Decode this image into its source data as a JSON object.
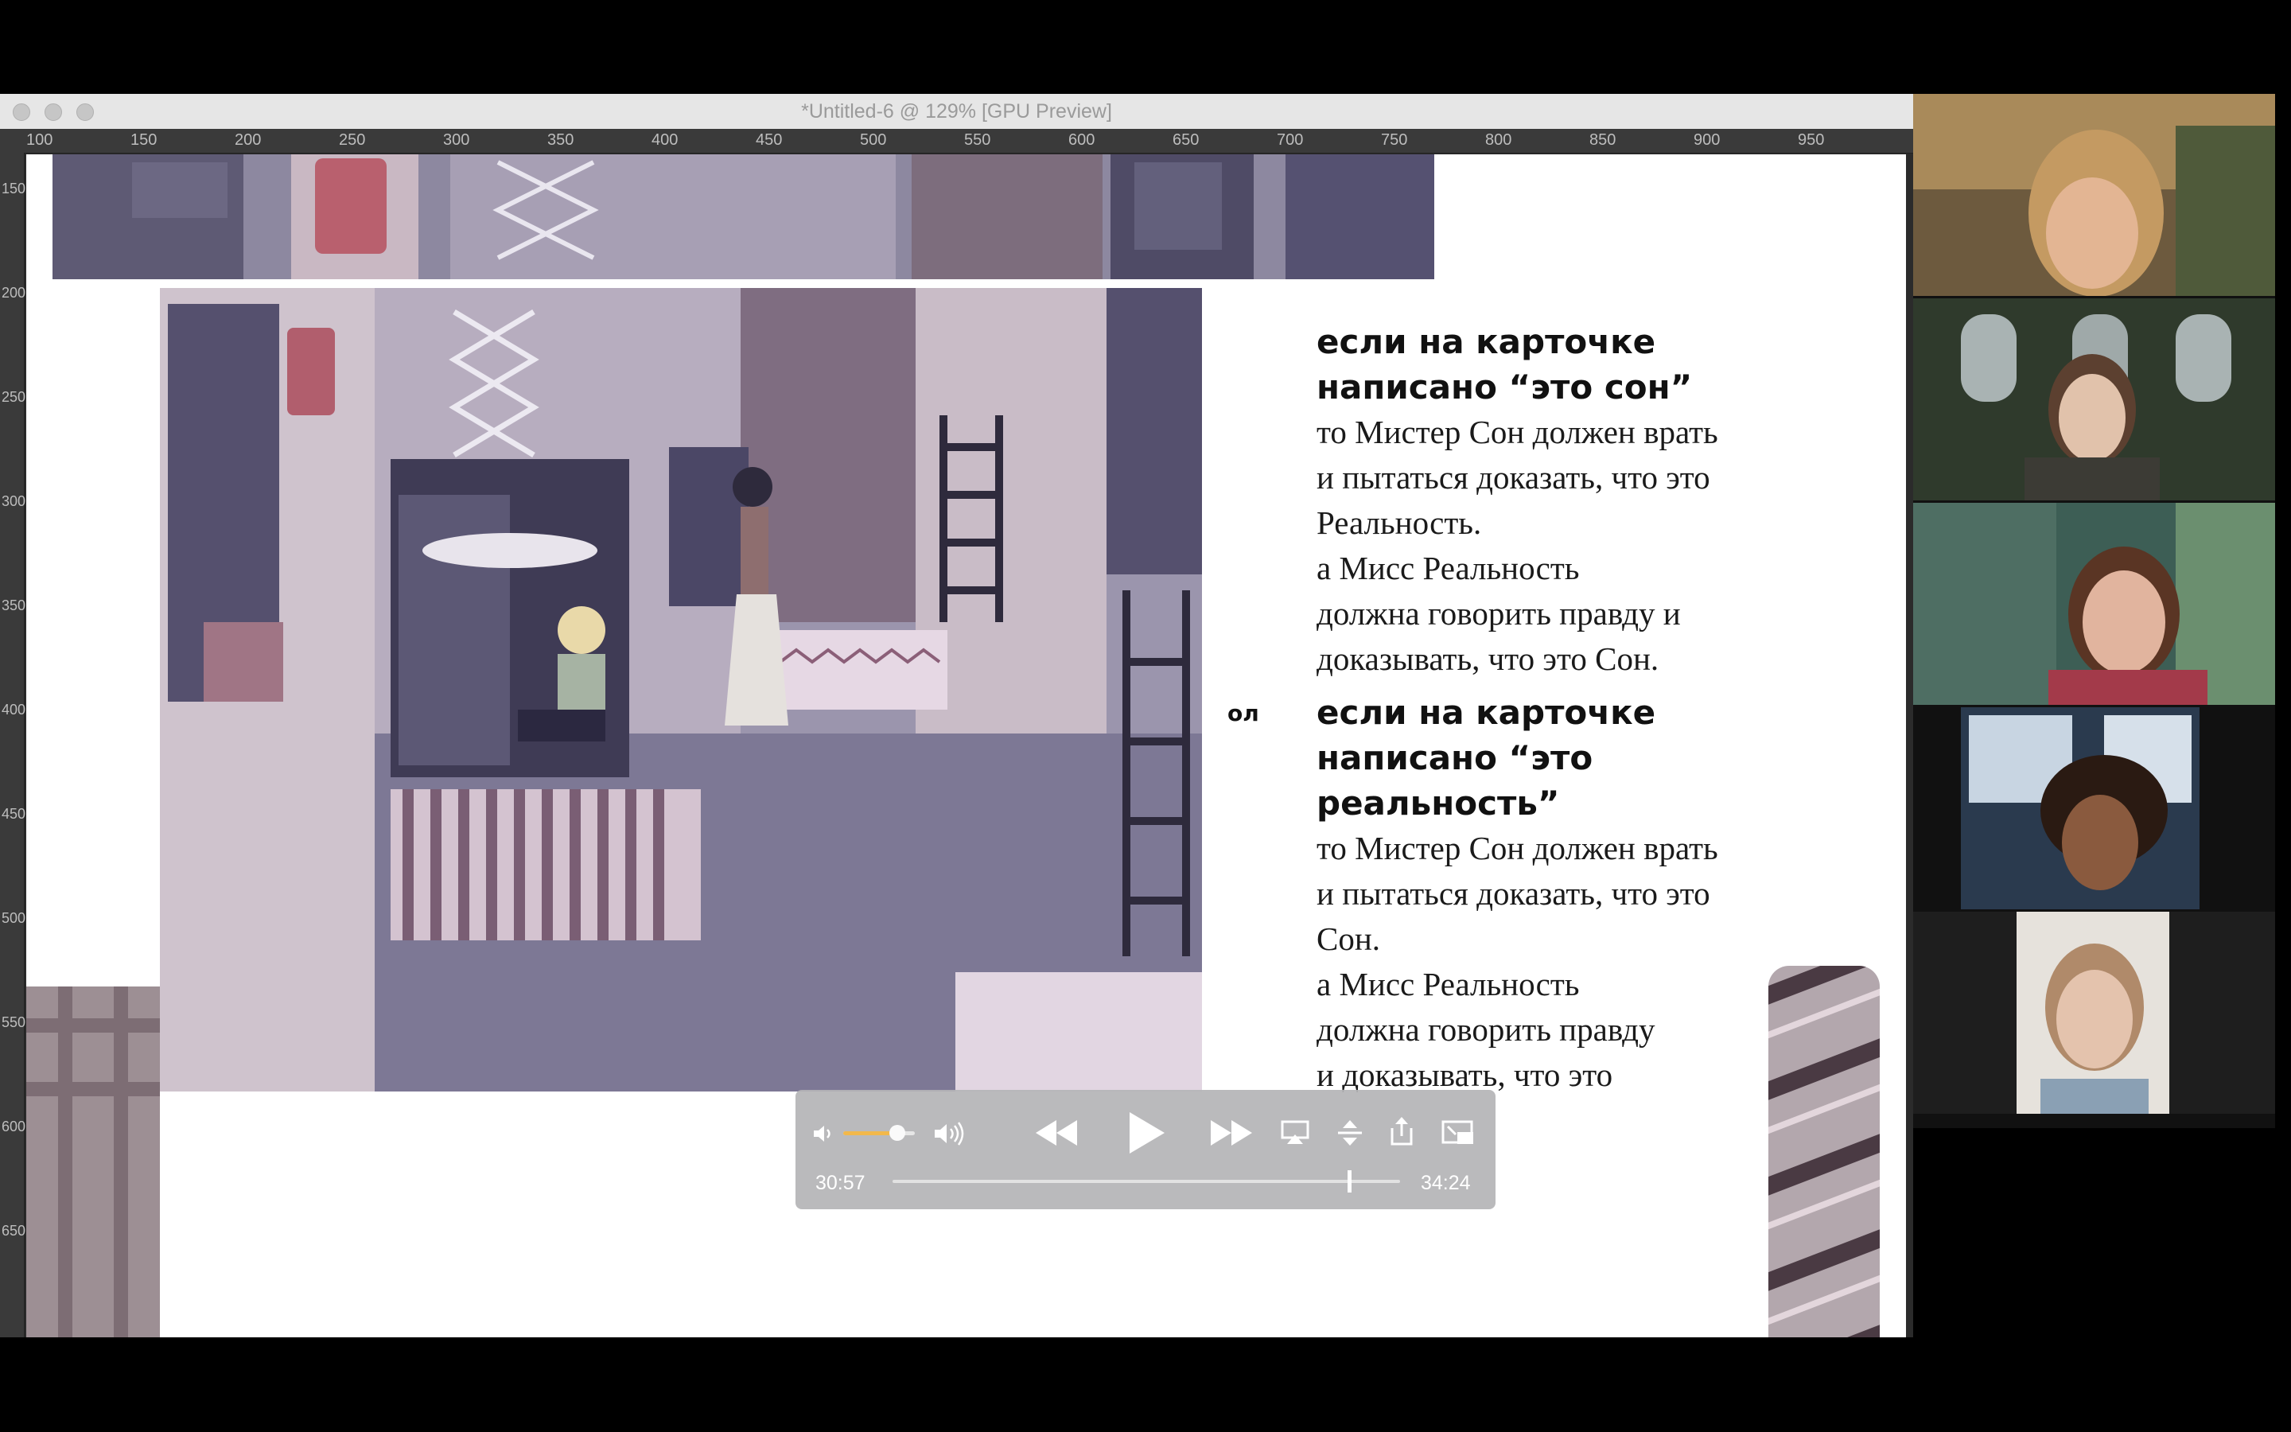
{
  "window": {
    "title": "*Untitled-6 @ 129% [GPU Preview]"
  },
  "ruler": {
    "top_labels": [
      "100",
      "150",
      "200",
      "250",
      "300",
      "350",
      "400",
      "450",
      "500",
      "550",
      "600",
      "650",
      "700",
      "750",
      "800",
      "850",
      "900",
      "950"
    ],
    "left_labels": [
      "150",
      "200",
      "250",
      "300",
      "350",
      "400",
      "450",
      "500",
      "550",
      "600",
      "650"
    ]
  },
  "page": {
    "block1": {
      "heading": [
        "если на карточке",
        "написано “это сон”"
      ],
      "lines": [
        "то Мистер Сон должен врать",
        "и пытаться доказать, что это",
        "Реальность.",
        "а Мисс Реальность",
        "должна говорить правду и",
        "доказывать, что это Сон."
      ]
    },
    "block2": {
      "heading": [
        "если на карточке",
        "написано “это",
        "реальность”"
      ],
      "lines": [
        "то Мистер Сон должен врать",
        "и пытаться доказать, что это",
        "Сон.",
        "а Мисс Реальность",
        "должна говорить правду",
        "и доказывать, что это",
        "."
      ]
    },
    "stray_text": "ол"
  },
  "player": {
    "current_time": "30:57",
    "total_time": "34:24",
    "progress": 0.9,
    "volume": 0.75
  },
  "participants": {
    "count": 5
  },
  "colors": {
    "illustration_purple": "#8f8aa2",
    "player_bg": "#b4b4b6"
  }
}
